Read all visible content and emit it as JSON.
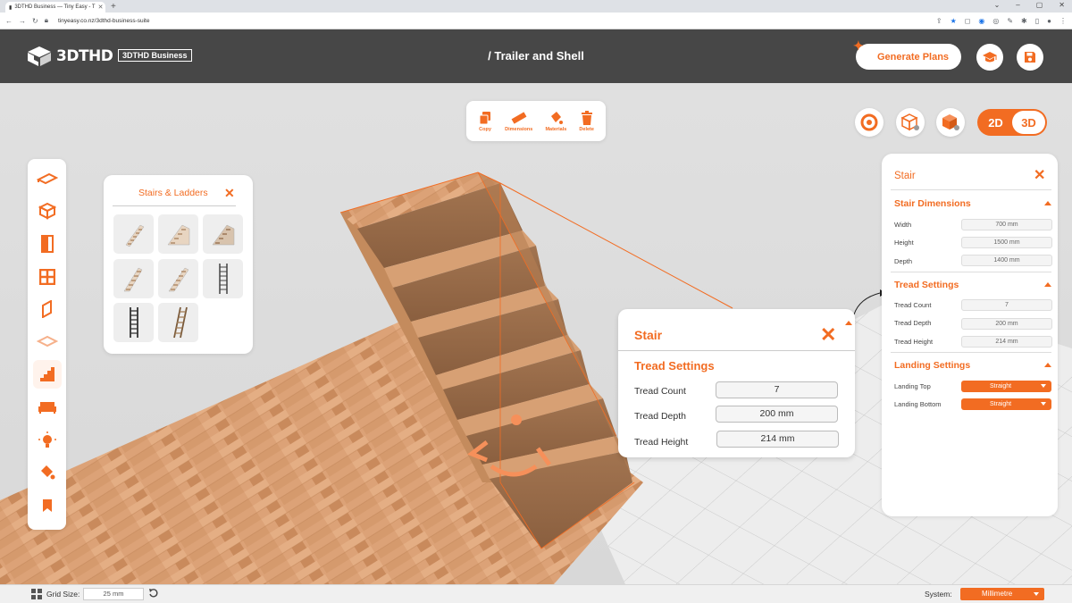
{
  "browser": {
    "tab_title": "3DTHD Business — Tiny Easy - T",
    "url": "tinyeasy.co.nz/3dthd-business-suite"
  },
  "header": {
    "logo_text": "3DTHD",
    "badge": "3DTHD Business",
    "title": "/ Trailer and Shell",
    "generate_label": "Generate Plans"
  },
  "toolbar": {
    "copy": "Copy",
    "dimensions": "Dimensions",
    "materials": "Materials",
    "delete": "Delete"
  },
  "view": {
    "two_d": "2D",
    "three_d": "3D",
    "active": "3D"
  },
  "stairs_panel": {
    "title": "Stairs & Ladders"
  },
  "popup": {
    "title": "Stair",
    "section": "Tread Settings",
    "fields": [
      {
        "label": "Tread Count",
        "value": "7"
      },
      {
        "label": "Tread Depth",
        "value": "200 mm"
      },
      {
        "label": "Tread Height",
        "value": "214 mm"
      }
    ]
  },
  "props": {
    "title": "Stair",
    "dimensions": {
      "title": "Stair Dimensions",
      "rows": [
        {
          "label": "Width",
          "value": "700 mm"
        },
        {
          "label": "Height",
          "value": "1500 mm"
        },
        {
          "label": "Depth",
          "value": "1400 mm"
        }
      ]
    },
    "tread": {
      "title": "Tread Settings",
      "rows": [
        {
          "label": "Tread Count",
          "value": "7"
        },
        {
          "label": "Tread Depth",
          "value": "200 mm"
        },
        {
          "label": "Tread Height",
          "value": "214 mm"
        }
      ]
    },
    "landing": {
      "title": "Landing Settings",
      "rows": [
        {
          "label": "Landing Top",
          "value": "Straight"
        },
        {
          "label": "Landing Bottom",
          "value": "Straight"
        }
      ]
    }
  },
  "bottom": {
    "grid_label": "Grid Size:",
    "grid_value": "25 mm",
    "system_label": "System:",
    "system_value": "Millimetre"
  },
  "colors": {
    "accent": "#f26c22",
    "header_bg": "#474747"
  }
}
